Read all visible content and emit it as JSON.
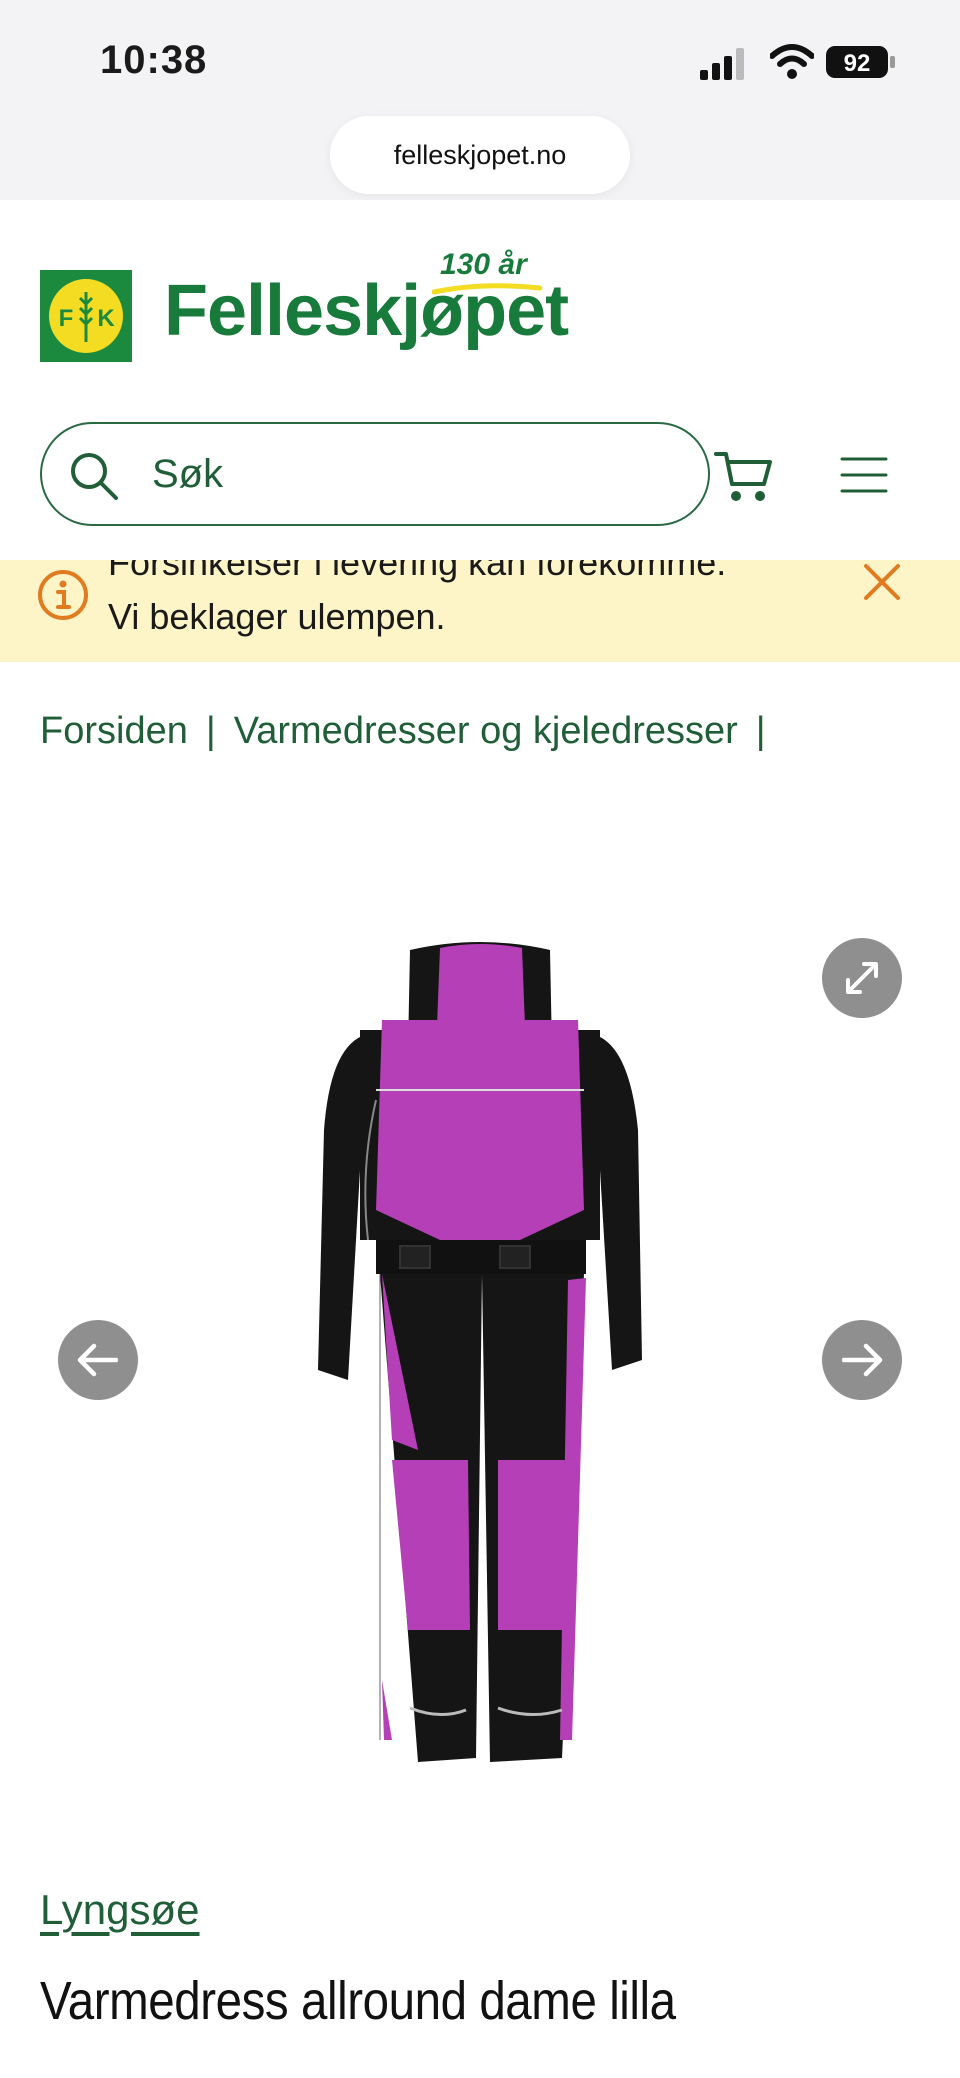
{
  "status_bar": {
    "time": "10:38",
    "battery": "92",
    "url": "felleskjopet.no"
  },
  "header": {
    "logo_letters": "FK",
    "brand_name": "Felleskjøpet",
    "anniversary": "130 år",
    "search_placeholder": "Søk"
  },
  "notice": {
    "line1": "Forsinkelser i levering kan forekomme.",
    "line2": "Vi beklager ulempen."
  },
  "breadcrumb": {
    "items": [
      "Forsiden",
      "Varmedresser og kjeledresser"
    ],
    "separator": "|"
  },
  "product": {
    "brand": "Lyngsøe",
    "title": "Varmedress allround dame lilla"
  },
  "colors": {
    "brand_green": "#187a3b",
    "link_green": "#1f5e37",
    "notice_bg": "#fdf4c7",
    "notice_accent": "#e07b1f",
    "logo_yellow": "#f3dc22",
    "suit_purple": "#b43fb6",
    "suit_black": "#151515"
  },
  "icons": {
    "search": "search-icon",
    "cart": "cart-icon",
    "menu": "menu-icon",
    "info": "info-icon",
    "close": "close-icon",
    "expand": "expand-icon",
    "prev": "arrow-left-icon",
    "next": "arrow-right-icon"
  }
}
